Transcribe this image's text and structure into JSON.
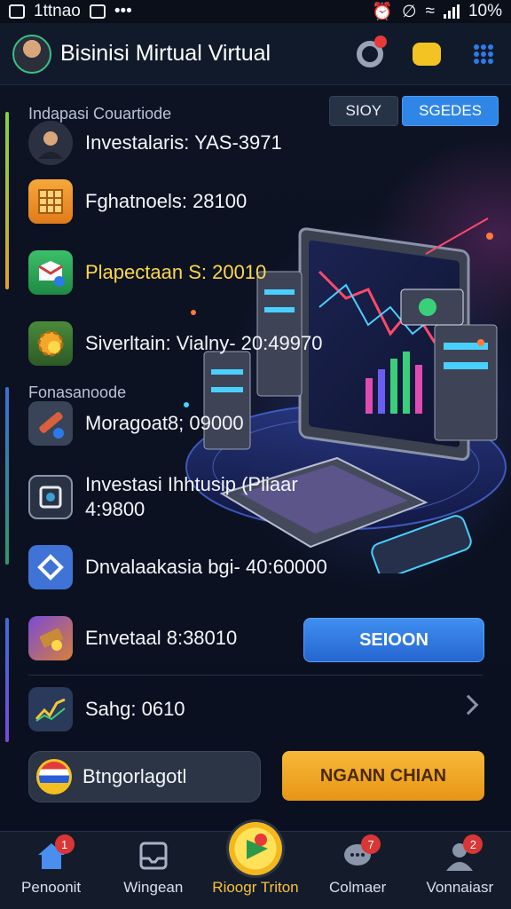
{
  "status_bar": {
    "time": "1ttnao",
    "battery": "10%"
  },
  "header": {
    "title": "Bisinisi Mirtual Virtual"
  },
  "section_top": {
    "label": "Indapasi Couartiode",
    "tabs": [
      "SIOY",
      "SGEDES"
    ],
    "active_tab": "SGEDES"
  },
  "section_mid": {
    "label": "Fonasanoode"
  },
  "rows": [
    {
      "text": "Investalaris: YAS-3971",
      "icon": "person-avatar-icon"
    },
    {
      "text": "Fghatnoels: 28100",
      "icon": "grid-table-icon"
    },
    {
      "text": "Plapectaan S: 20010",
      "icon": "mail-badge-icon"
    },
    {
      "text": "Siverltain: Vialny- 20:49970",
      "icon": "gear-coin-icon"
    },
    {
      "text": "Moragoat8; 09000",
      "icon": "tool-icon"
    },
    {
      "text": "Investasi Ihhtusip (Pliaar",
      "text2": "4:9800",
      "icon": "square-target-icon"
    },
    {
      "text": "Dnvalaakasia bgi- 40:60000",
      "icon": "diamond-link-icon"
    },
    {
      "text": "Envetaal 8:38010",
      "icon": "box-coin-icon"
    },
    {
      "text": "Sahg: 0610",
      "icon": "line-chart-icon"
    }
  ],
  "buttons": {
    "blue": "SEIOON",
    "orange": "NGANN CHIAN",
    "pill": "Btngorlagotl"
  },
  "nav": [
    {
      "label": "Penoonit",
      "icon": "home-icon",
      "badge": "1"
    },
    {
      "label": "Wingean",
      "icon": "inbox-icon",
      "badge": ""
    },
    {
      "label": "Rioogr Triton",
      "icon": "play-fab-icon",
      "badge": "",
      "active": true
    },
    {
      "label": "Colmaer",
      "icon": "chat-bubble-icon",
      "badge": "7"
    },
    {
      "label": "Vonnaiasr",
      "icon": "user-icon",
      "badge": "2"
    }
  ],
  "colors": {
    "accent_blue": "#2f86e6",
    "accent_orange": "#f3a52a",
    "accent_yellow": "#ffd84a",
    "background": "#0c1220"
  }
}
